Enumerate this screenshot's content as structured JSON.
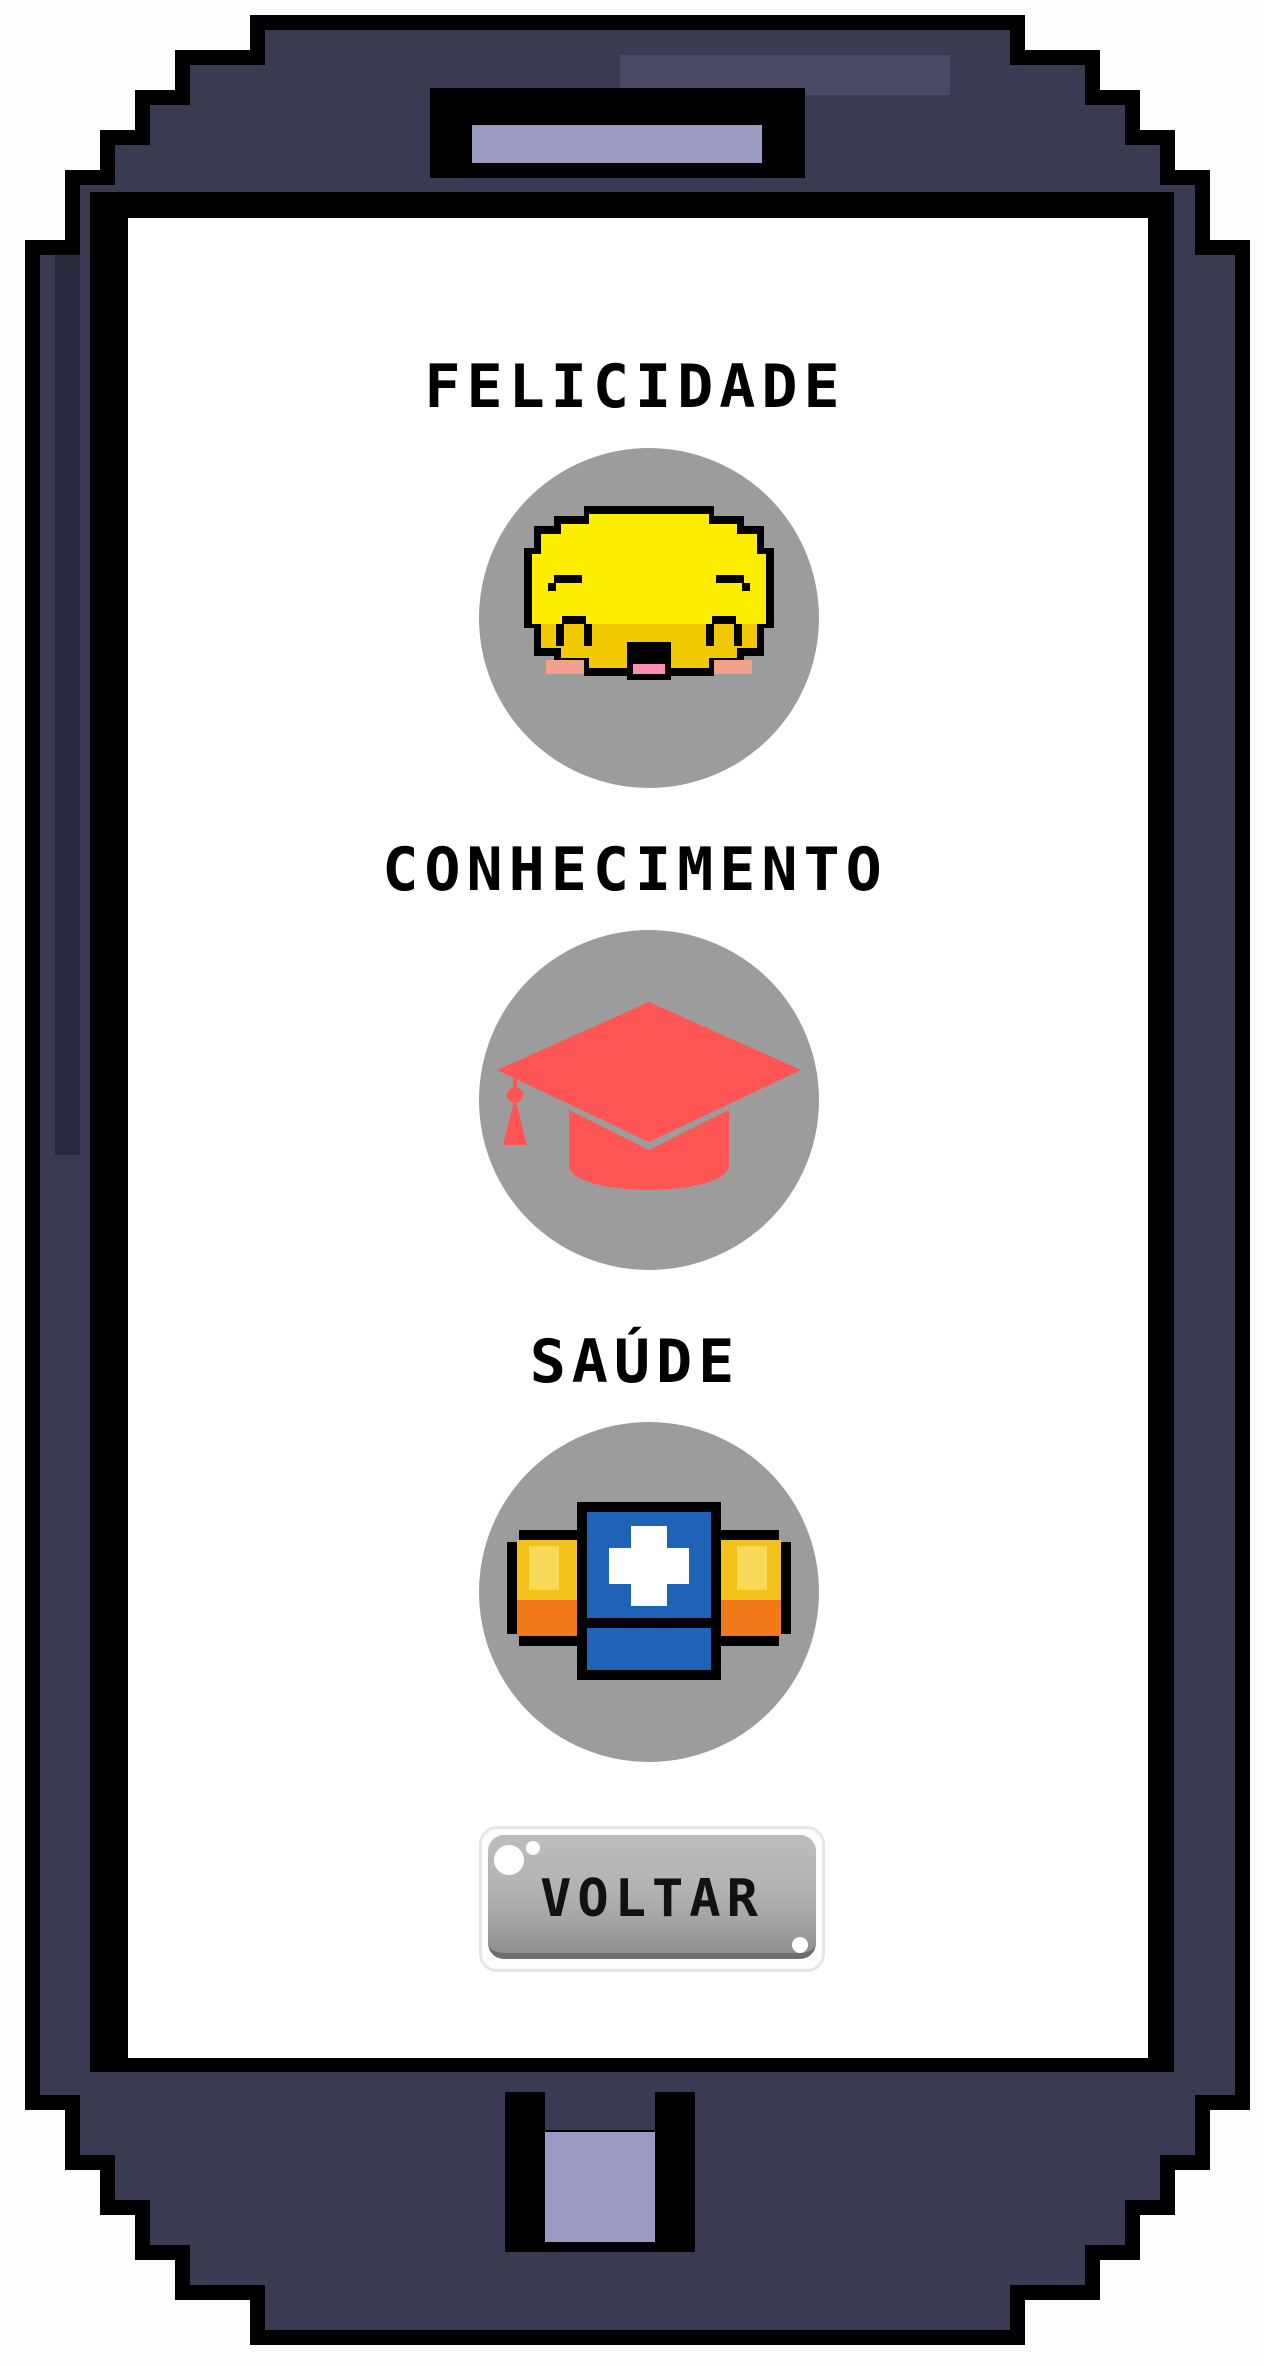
{
  "screen": {
    "sections": [
      {
        "label": "FELICIDADE",
        "icon": "smiley-face-icon"
      },
      {
        "label": "CONHECIMENTO",
        "icon": "graduation-cap-icon"
      },
      {
        "label": "SAÚDE",
        "icon": "medicine-capsule-icon"
      }
    ],
    "back_button": {
      "label": "VOLTAR"
    }
  },
  "colors": {
    "phone_body": "#3a3a52",
    "phone_outline": "#000000",
    "screen_bg": "#ffffff",
    "circle_bg": "#9c9c9c",
    "smiley_yellow": "#ffee00",
    "cap_red": "#ff5555",
    "capsule_blue": "#1e63b8",
    "capsule_orange": "#f07a1a"
  }
}
